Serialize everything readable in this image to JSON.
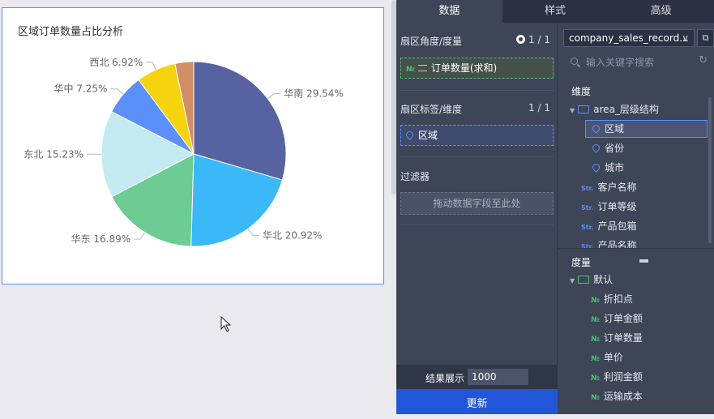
{
  "chart_data": {
    "type": "pie",
    "title": "区域订单数量占比分析",
    "slices": [
      {
        "label": "华南",
        "value": 29.54,
        "display": "华南 29.54%",
        "color": "#5763a0"
      },
      {
        "label": "华北",
        "value": 20.92,
        "display": "华北 20.92%",
        "color": "#3ab8f8"
      },
      {
        "label": "华东",
        "value": 16.89,
        "display": "华东 16.89%",
        "color": "#6ccc93"
      },
      {
        "label": "东北",
        "value": 15.23,
        "display": "东北 15.23%",
        "color": "#c4eaf2"
      },
      {
        "label": "华中",
        "value": 7.25,
        "display": "华中 7.25%",
        "color": "#5b8ff9"
      },
      {
        "label": "西北",
        "value": 6.92,
        "display": "西北 6.92%",
        "color": "#f5d40f"
      },
      {
        "label": "",
        "value": 3.25,
        "display": "",
        "color": "#d28f66"
      }
    ]
  },
  "tabs": [
    {
      "label": "数据",
      "active": true
    },
    {
      "label": "样式",
      "active": false
    },
    {
      "label": "高级",
      "active": false
    }
  ],
  "left": {
    "angle_title": "扇区角度/度量",
    "angle_count": "1 / 1",
    "angle_field": "订单数量(求和)",
    "measure_badge": "№",
    "label_title": "扇区标签/维度",
    "label_count": "1 / 1",
    "label_field": "区域",
    "filter_title": "过滤器",
    "filter_placeholder": "拖动数据字段至此处",
    "result_label": "结果展示",
    "result_value": "1000",
    "update_button": "更新"
  },
  "right": {
    "dataset": "company_sales_record...",
    "search_placeholder": "输入关键字搜索",
    "dimension_header": "维度",
    "dimension_folder": "area_层级结构",
    "dimension_geo": [
      "区域",
      "省份",
      "城市"
    ],
    "str_badge": "Str.",
    "dimension_str": [
      "客户名称",
      "订单等级",
      "产品包箱",
      "产品名称"
    ],
    "measure_header": "度量",
    "measure_folder": "默认",
    "num_badge": "№",
    "measures": [
      "折扣点",
      "订单金额",
      "订单数量",
      "单价",
      "利润金额",
      "运输成本"
    ]
  }
}
